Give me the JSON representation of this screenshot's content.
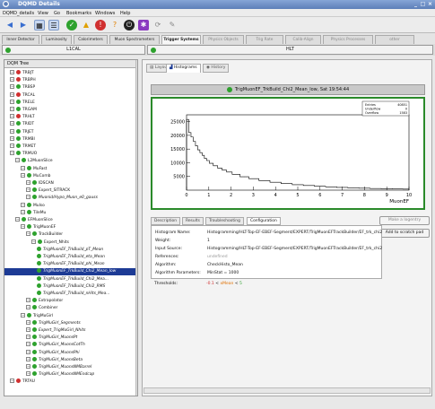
{
  "window": {
    "title": "DQMD Details"
  },
  "menu": [
    "DQMD_details",
    "View",
    "Go",
    "Bookmarks",
    "Windows",
    "Help"
  ],
  "toolbar": {
    "icons": [
      "back-icon",
      "forward-icon",
      "grid-icon",
      "list-icon",
      "status-ok-icon",
      "warning-icon",
      "error-icon",
      "info-icon",
      "power-icon",
      "puzzle-icon",
      "refresh-icon",
      "config-icon"
    ]
  },
  "tabs": [
    "Inner Detector",
    "Luminosity",
    "Calorimeters",
    "Muon Spectrometers",
    "Trigger Systems",
    "Physics Objects",
    "Trig Rate",
    "Calib-Align",
    "Physics Processes",
    "other"
  ],
  "active_tab": "Trigger Systems",
  "status": {
    "left": "L1CAL",
    "right": "HLT"
  },
  "tree": {
    "header": "DQM Tree",
    "nodes": [
      {
        "label": "TRBJT",
        "status": "error",
        "depth": 1
      },
      {
        "label": "TRBPH",
        "status": "error",
        "depth": 1
      },
      {
        "label": "TRBSP",
        "status": "ok",
        "depth": 1
      },
      {
        "label": "TRCAL",
        "status": "error",
        "depth": 1
      },
      {
        "label": "TRELE",
        "status": "ok",
        "depth": 1
      },
      {
        "label": "TRGAM",
        "status": "ok",
        "depth": 1
      },
      {
        "label": "TRHLT",
        "status": "error",
        "depth": 1
      },
      {
        "label": "TRIDT",
        "status": "ok",
        "depth": 1
      },
      {
        "label": "TRJET",
        "status": "ok",
        "depth": 1
      },
      {
        "label": "TRMBI",
        "status": "ok",
        "depth": 1
      },
      {
        "label": "TRMET",
        "status": "ok",
        "depth": 1
      },
      {
        "label": "TRMUO",
        "status": "ok",
        "depth": 1
      },
      {
        "label": "L2MuonSlice",
        "status": "ok",
        "depth": 2
      },
      {
        "label": "MuFast",
        "status": "ok",
        "depth": 3
      },
      {
        "label": "MuComb",
        "status": "ok",
        "depth": 3
      },
      {
        "label": "IDSCAN",
        "status": "ok",
        "depth": 4
      },
      {
        "label": "Expert_SITRACK",
        "status": "ok",
        "depth": 4
      },
      {
        "label": "Muonid/Hypo_Muon_e0_gauss",
        "status": "ok",
        "depth": 4
      },
      {
        "label": "MuIso",
        "status": "ok",
        "depth": 3
      },
      {
        "label": "TileMu",
        "status": "ok",
        "depth": 3
      },
      {
        "label": "EFMuonSlice",
        "status": "ok",
        "depth": 2
      },
      {
        "label": "TrigMuonEF",
        "status": "ok",
        "depth": 3
      },
      {
        "label": "TrackBuilder",
        "status": "ok",
        "depth": 4
      },
      {
        "label": "Expert_Nhits",
        "status": "ok",
        "depth": 5
      },
      {
        "label": "TrigMuonEF_TrkBuild_pT_Mean",
        "status": "ok",
        "depth": 6
      },
      {
        "label": "TrigMuonEF_TrkBuild_eta_Mean",
        "status": "ok",
        "depth": 6
      },
      {
        "label": "TrigMuonEF_TrkBuild_phi_Mean",
        "status": "ok",
        "depth": 6
      },
      {
        "label": "TrigMuonEF_TrkBuild_Chi2_Mean_low",
        "status": "ok",
        "depth": 6
      },
      {
        "label": "TrigMuonEF_TrkBuild_Chi2_Mea...",
        "status": "ok",
        "depth": 6
      },
      {
        "label": "TrigMuonEF_TrkBuild_Chi2_RMS",
        "status": "ok",
        "depth": 6
      },
      {
        "label": "TrigMuonEF_TrkBuild_nHits_Mea...",
        "status": "ok",
        "depth": 6
      },
      {
        "label": "Extrapolator",
        "status": "ok",
        "depth": 4
      },
      {
        "label": "Combiner",
        "status": "ok",
        "depth": 4
      },
      {
        "label": "TrigMuGirl",
        "status": "ok",
        "depth": 3
      },
      {
        "label": "TrigMuGirl_Segments",
        "status": "ok",
        "depth": 4
      },
      {
        "label": "Expert_TrigMuGirl_Nhits",
        "status": "ok",
        "depth": 4
      },
      {
        "label": "TrigMuGirl_MuonsPt",
        "status": "ok",
        "depth": 4
      },
      {
        "label": "TrigMuGirl_MuonsCotTh",
        "status": "ok",
        "depth": 4
      },
      {
        "label": "TrigMuGirl_MuonsPhi",
        "status": "ok",
        "depth": 4
      },
      {
        "label": "TrigMuGirl_MuonsBeta",
        "status": "ok",
        "depth": 4
      },
      {
        "label": "TrigMuGirl_MuonsNMBarrel",
        "status": "ok",
        "depth": 4
      },
      {
        "label": "TrigMuGirl_MuonsNMEndcap",
        "status": "ok",
        "depth": 4
      },
      {
        "label": "TRTAU",
        "status": "error",
        "depth": 1
      }
    ],
    "selected_index": 27
  },
  "right_tabs": [
    "Layout",
    "Histograms",
    "History"
  ],
  "active_right_tab": "Histograms",
  "histogram": {
    "title": "TrigMuonEF_TrkBuild_Chi2_Mean_low, Sat 19:54:44",
    "stats": {
      "entries_label": "Entries",
      "entries": "40851",
      "underflow_label": "Underflow",
      "underflow": "0",
      "overflow_label": "Overflow",
      "overflow": "1583"
    },
    "xaxis_title": "MuonEF"
  },
  "chart_data": {
    "type": "bar",
    "title": "",
    "xlabel": "MuonEF",
    "ylabel": "",
    "xlim": [
      0,
      10
    ],
    "ylim": [
      0,
      27500
    ],
    "xticks": [
      0,
      1,
      2,
      3,
      4,
      5,
      6,
      7,
      8,
      9,
      10
    ],
    "yticks": [
      5000,
      10000,
      15000,
      20000,
      25000
    ],
    "x": [
      0.05,
      0.15,
      0.25,
      0.35,
      0.45,
      0.55,
      0.65,
      0.75,
      0.85,
      0.95,
      1.1,
      1.3,
      1.5,
      1.7,
      1.9,
      2.2,
      2.6,
      3.0,
      3.5,
      4.0,
      4.5,
      5.0,
      5.5,
      6.0,
      6.5,
      7.0,
      7.5,
      8.0,
      8.5,
      9.0,
      9.5,
      9.95
    ],
    "values": [
      25800,
      21000,
      19400,
      17800,
      16200,
      14700,
      13700,
      12700,
      11600,
      10800,
      9800,
      8900,
      8000,
      7300,
      6600,
      5800,
      4900,
      4200,
      3500,
      2900,
      2400,
      2000,
      1700,
      1400,
      1200,
      1000,
      850,
      700,
      600,
      500,
      420,
      380
    ]
  },
  "detail_tabs": [
    "Description",
    "Results",
    "Troubleshooting",
    "Configuration"
  ],
  "active_detail_tab": "Configuration",
  "config": [
    {
      "key": "Histogram Name:",
      "value": "Histogramming/HLT-Top-EF-EBEF-Segment/EXPERT/TrigMuonEFTrackBuilder/EF_trk_chi2"
    },
    {
      "key": "Weight:",
      "value": "1"
    },
    {
      "key": "Input Source:",
      "value": "Histogramming/HLT-Top-EF-EBEF-Segment/EXPERT/TrigMuonEFTrackBuilder/EF_trk_chi2"
    },
    {
      "key": "References:",
      "value": "undefined"
    },
    {
      "key": "Algorithm:",
      "value": "CheckHisto_Mean"
    },
    {
      "key": "Algorithm Parameters:",
      "value": "MinStat = 1000"
    },
    {
      "key": "Thresholds:",
      "value_red": "-0.1",
      "value_sep": "<",
      "value_mid": "xMean",
      "value_sep2": "<",
      "value_green": "5"
    }
  ],
  "buttons": {
    "make_a_logentry": "Make a logentry",
    "add_to_scratch_pad": "Add to scratch pad"
  },
  "colors": {
    "ok": "#2ea22e",
    "error": "#d03030",
    "selection": "#1d3b95",
    "plot_frame": "#2a8a2a"
  }
}
